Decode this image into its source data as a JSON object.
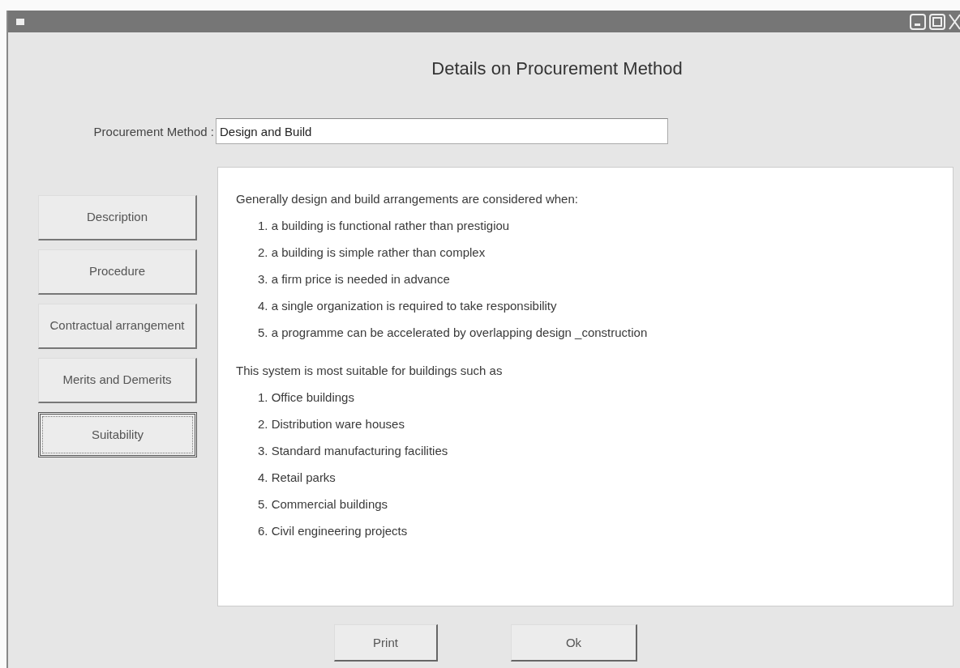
{
  "window": {
    "heading": "Details on Procurement Method"
  },
  "procurement_method": {
    "label": "Procurement Method :",
    "value": "Design and Build"
  },
  "nav_buttons": [
    {
      "label": "Description",
      "selected": false
    },
    {
      "label": "Procedure",
      "selected": false
    },
    {
      "label": "Contractual arrangement",
      "selected": false
    },
    {
      "label": "Merits and Demerits",
      "selected": false
    },
    {
      "label": "Suitability",
      "selected": true
    }
  ],
  "content": [
    {
      "intro": "Generally design and build arrangements are considered when:",
      "items": [
        "1. a building is functional rather than prestigiou",
        "2. a building is simple rather than complex",
        "3. a firm price is needed in advance",
        "4. a single organization is required to take responsibility",
        "5. a programme can be accelerated by overlapping design _construction"
      ]
    },
    {
      "intro": "This system is most suitable for buildings such as",
      "items": [
        "1. Office buildings",
        "2. Distribution ware houses",
        "3. Standard manufacturing facilities",
        "4. Retail parks",
        "5. Commercial buildings",
        "6. Civil engineering projects"
      ]
    }
  ],
  "buttons": [
    "Print",
    "Ok"
  ]
}
